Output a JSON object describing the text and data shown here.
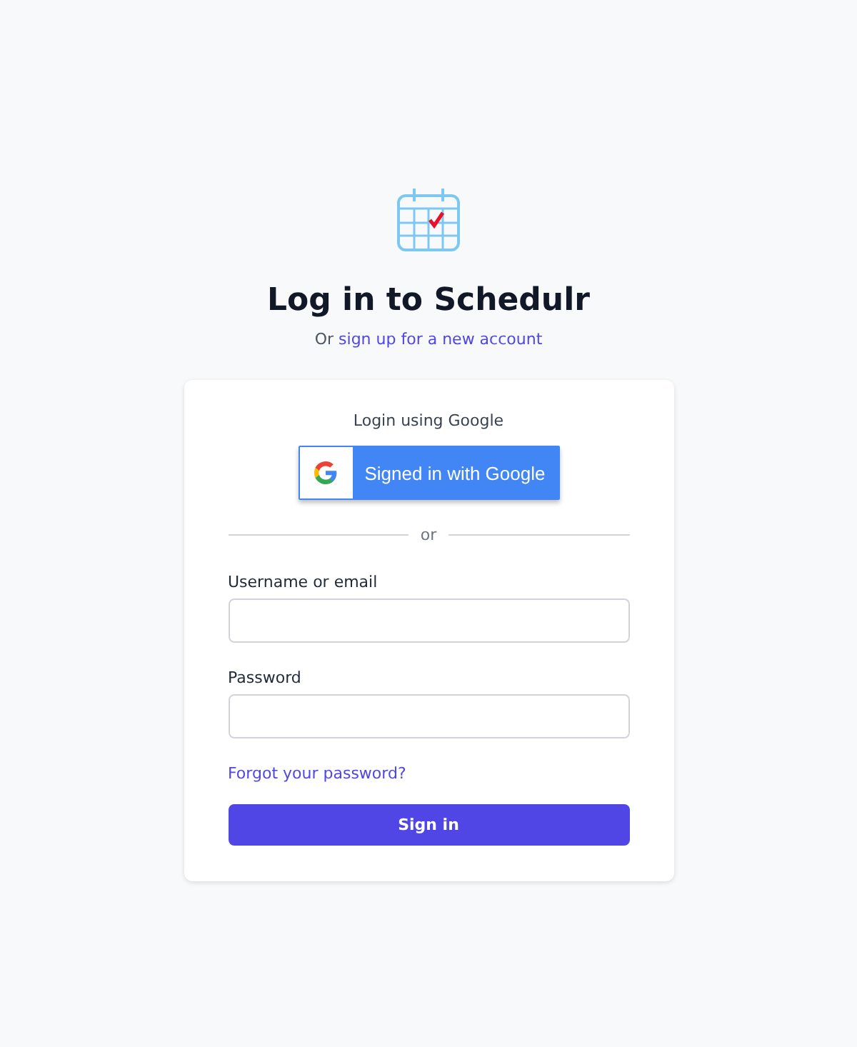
{
  "header": {
    "title": "Log in to Schedulr",
    "subtitle_prefix": "Or",
    "signup_link": "sign up for a new account"
  },
  "google": {
    "label": "Login using Google",
    "button": "Signed in with Google"
  },
  "divider": "or",
  "fields": [
    {
      "label": "Username or email"
    },
    {
      "label": "Password"
    }
  ],
  "forgot_link": "Forgot your password?",
  "submit": "Sign in"
}
